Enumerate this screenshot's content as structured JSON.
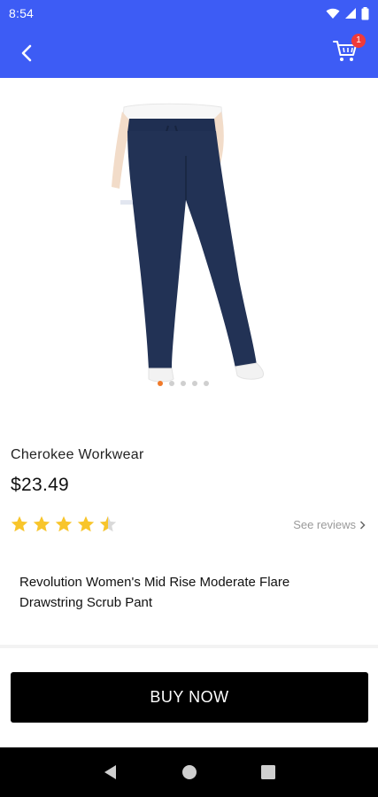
{
  "status_bar": {
    "time": "8:54"
  },
  "app_bar": {
    "back_icon": "chevron-left-icon",
    "cart_icon": "shopping-cart-icon",
    "cart_count": "1",
    "color": "#3d5cf5"
  },
  "product": {
    "image": "navy-scrub-pant-photo",
    "carousel": {
      "total": 5,
      "active_index": 0
    },
    "brand": "Cherokee Workwear",
    "price": "$23.49",
    "rating": 4.5,
    "rating_max": 5,
    "see_reviews_label": "See reviews",
    "description": "Revolution Women's Mid Rise Moderate Flare Drawstring Scrub Pant"
  },
  "actions": {
    "buy_now_label": "BUY NOW"
  },
  "colors": {
    "accent": "#3d5cf5",
    "star": "#f8c52b",
    "carousel_active": "#f07a2a",
    "badge": "#f03a3a"
  }
}
